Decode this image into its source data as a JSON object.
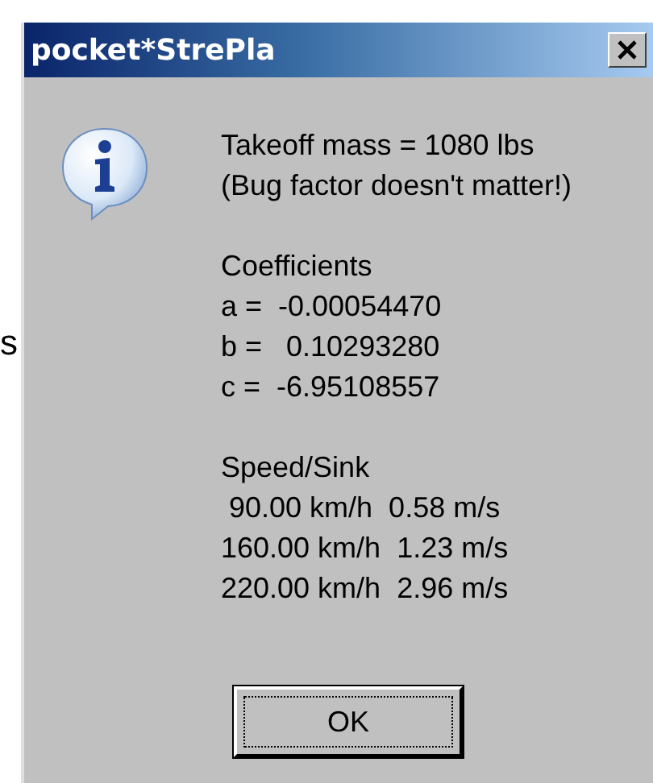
{
  "background_text": "s",
  "window": {
    "title": "pocket*StrePla"
  },
  "message": {
    "paragraphs": [
      {
        "lines": [
          "Takeoff mass = 1080 lbs",
          "(Bug factor doesn't matter!)"
        ]
      },
      {
        "lines": [
          "Coefficients",
          "a =  -0.00054470",
          "b =   0.10293280",
          "c =  -6.95108557"
        ]
      },
      {
        "lines": [
          "Speed/Sink",
          " 90.00 km/h  0.58 m/s",
          "160.00 km/h  1.23 m/s",
          "220.00 km/h  2.96 m/s"
        ]
      }
    ]
  },
  "buttons": [
    {
      "label": "OK",
      "focused": true
    }
  ]
}
